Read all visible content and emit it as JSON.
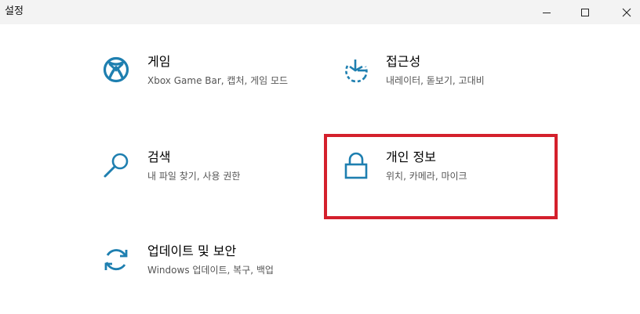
{
  "window": {
    "title": "설정",
    "controls": {
      "minimize": "minimize-icon",
      "maximize": "maximize-icon",
      "close": "close-icon"
    }
  },
  "colors": {
    "accent": "#1e7fb0",
    "highlight": "#d4202c",
    "titlebar": "#f3f3f3"
  },
  "tiles": [
    {
      "id": "gaming",
      "icon": "xbox-icon",
      "title": "게임",
      "description": "Xbox Game Bar, 캡처, 게임 모드"
    },
    {
      "id": "ease-of-access",
      "icon": "ease-of-access-icon",
      "title": "접근성",
      "description": "내레이터, 돋보기, 고대비"
    },
    {
      "id": "search",
      "icon": "search-icon",
      "title": "검색",
      "description": "내 파일 찾기, 사용 권한"
    },
    {
      "id": "privacy",
      "icon": "lock-icon",
      "title": "개인 정보",
      "description": "위치, 카메라, 마이크"
    },
    {
      "id": "update-security",
      "icon": "sync-icon",
      "title": "업데이트 및 보안",
      "description": "Windows 업데이트, 복구, 백업"
    }
  ]
}
